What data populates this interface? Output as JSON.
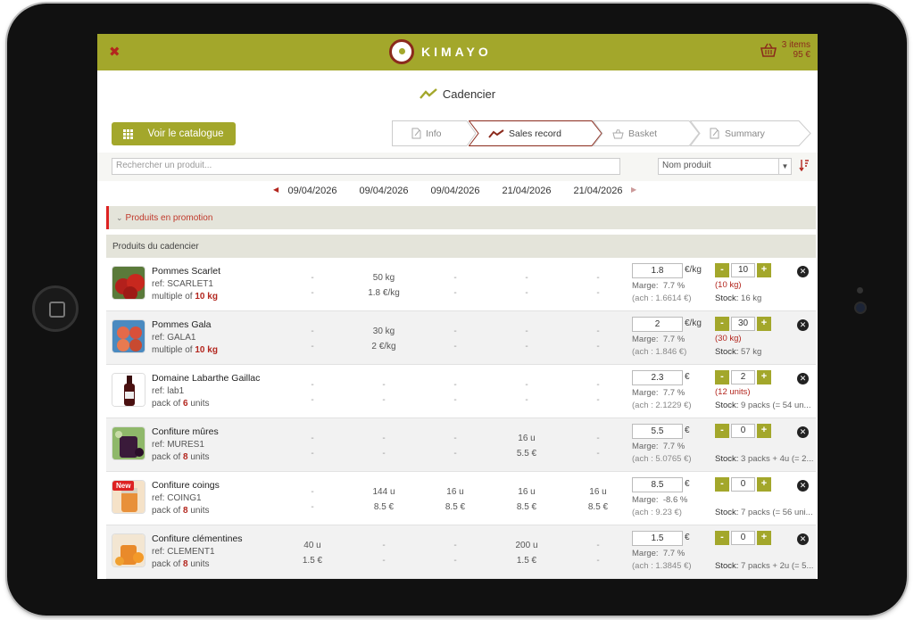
{
  "app": {
    "logo_text": "KIMAYO",
    "close_symbol": "✖"
  },
  "cart": {
    "items": "3 items",
    "total": "95 €"
  },
  "page_title": "Cadencier",
  "catalog_button": "Voir le catalogue",
  "steps": [
    {
      "label": "Info",
      "icon": "document-icon"
    },
    {
      "label": "Sales record",
      "icon": "trend-icon"
    },
    {
      "label": "Basket",
      "icon": "basket-icon"
    },
    {
      "label": "Summary",
      "icon": "edit-icon"
    }
  ],
  "search": {
    "placeholder": "Rechercher un produit..."
  },
  "sort": {
    "selected": "Nom produit"
  },
  "dates": [
    "09/04/2026",
    "09/04/2026",
    "09/04/2026",
    "21/04/2026",
    "21/04/2026"
  ],
  "sections": {
    "promo": "Produits en promotion",
    "cadencier": "Produits du cadencier"
  },
  "labels": {
    "marge": "Marge:",
    "stock": "Stock:"
  },
  "products": [
    {
      "name": "Pommes Scarlet",
      "ref": "ref: SCARLET1",
      "mult_prefix": "multiple of ",
      "mult_value": "10 kg",
      "hist": [
        [
          "-",
          "-"
        ],
        [
          "50 kg",
          "1.8 €/kg"
        ],
        [
          "-",
          "-"
        ],
        [
          "-",
          "-"
        ],
        [
          "-",
          "-"
        ]
      ],
      "price": "1.8",
      "unit": "€/kg",
      "marge": "7.7 %",
      "ach": "(ach : 1.6614 €)",
      "qty": "10",
      "qnote": "(10 kg)",
      "stock": "16 kg",
      "image": "apples-red",
      "new": false
    },
    {
      "name": "Pommes Gala",
      "ref": "ref: GALA1",
      "mult_prefix": "multiple of ",
      "mult_value": "10 kg",
      "hist": [
        [
          "-",
          "-"
        ],
        [
          "30 kg",
          "2 €/kg"
        ],
        [
          "-",
          "-"
        ],
        [
          "-",
          "-"
        ],
        [
          "-",
          "-"
        ]
      ],
      "price": "2",
      "unit": "€/kg",
      "marge": "7.7 %",
      "ach": "(ach : 1.846 €)",
      "qty": "30",
      "qnote": "(30 kg)",
      "stock": "57 kg",
      "image": "apples-gala",
      "new": false
    },
    {
      "name": "Domaine Labarthe Gaillac",
      "ref": "ref: lab1",
      "mult_prefix": "pack of ",
      "mult_value": "6",
      "mult_suffix": " units",
      "hist": [
        [
          "-",
          "-"
        ],
        [
          "-",
          "-"
        ],
        [
          "-",
          "-"
        ],
        [
          "-",
          "-"
        ],
        [
          "-",
          "-"
        ]
      ],
      "price": "2.3",
      "unit": "€",
      "marge": "7.7 %",
      "ach": "(ach : 2.1229 €)",
      "qty": "2",
      "qnote": "(12 units)",
      "stock": "9 packs (= 54 un...",
      "image": "wine-bottle",
      "new": false
    },
    {
      "name": "Confiture mûres",
      "ref": "ref: MURES1",
      "mult_prefix": "pack of ",
      "mult_value": "8",
      "mult_suffix": " units",
      "hist": [
        [
          "-",
          "-"
        ],
        [
          "-",
          "-"
        ],
        [
          "-",
          "-"
        ],
        [
          "16 u",
          "5.5 €"
        ],
        [
          "-",
          "-"
        ]
      ],
      "price": "5.5",
      "unit": "€",
      "marge": "7.7 %",
      "ach": "(ach : 5.0765 €)",
      "qty": "0",
      "qnote": "",
      "stock": "3 packs + 4u (= 2...",
      "image": "jam-blackberry",
      "new": false
    },
    {
      "name": "Confiture coings",
      "ref": "ref: COING1",
      "mult_prefix": "pack of ",
      "mult_value": "8",
      "mult_suffix": " units",
      "hist": [
        [
          "-",
          "-"
        ],
        [
          "144 u",
          "8.5 €"
        ],
        [
          "16 u",
          "8.5 €"
        ],
        [
          "16 u",
          "8.5 €"
        ],
        [
          "16 u",
          "8.5 €"
        ]
      ],
      "price": "8.5",
      "unit": "€",
      "marge": "-8.6 %",
      "ach": "(ach : 9.23 €)",
      "qty": "0",
      "qnote": "",
      "stock": "7 packs (= 56 uni...",
      "image": "jam-quince",
      "new": true,
      "new_label": "New"
    },
    {
      "name": "Confiture clémentines",
      "ref": "ref: CLEMENT1",
      "mult_prefix": "pack of ",
      "mult_value": "8",
      "mult_suffix": " units",
      "hist": [
        [
          "40 u",
          "1.5 €"
        ],
        [
          "-",
          "-"
        ],
        [
          "-",
          "-"
        ],
        [
          "200 u",
          "1.5 €"
        ],
        [
          "-",
          "-"
        ]
      ],
      "price": "1.5",
      "unit": "€",
      "marge": "7.7 %",
      "ach": "(ach : 1.3845 €)",
      "qty": "0",
      "qnote": "",
      "stock": "7 packs + 2u (= 5...",
      "image": "jam-clementine",
      "new": false
    }
  ],
  "colors": {
    "brand": "#a3a72b",
    "accent_red": "#b3261e",
    "section_bg": "#e4e4da"
  }
}
